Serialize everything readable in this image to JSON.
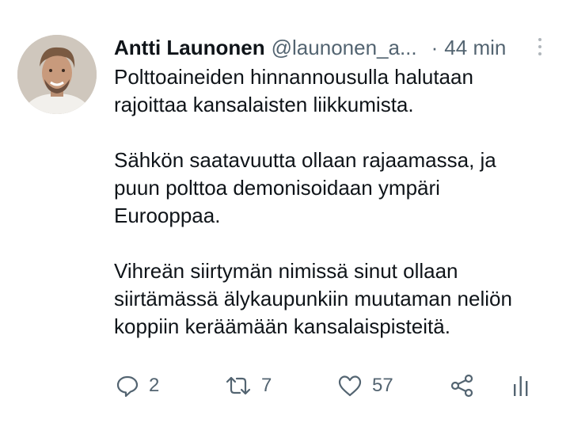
{
  "author": {
    "display_name": "Antti Launonen",
    "handle": "@launonen_a...",
    "separator": "·",
    "time": "44 min"
  },
  "tweet": {
    "lines": [
      "Polttoaineiden hinnannousulla halutaan",
      "rajoittaa kansalaisten liikkumista.",
      "Sähkön saatavuutta ollaan rajaamassa, ja",
      "puun polttoa demonisoidaan ympäri",
      "Eurooppaa.",
      "Vihreän siirtymän nimissä sinut ollaan",
      "siirtämässä älykaupunkiin muutaman neliön",
      "koppiin keräämään kansalaispisteitä."
    ]
  },
  "actions": {
    "reply": {
      "icon": "reply-icon",
      "count": "2"
    },
    "retweet": {
      "icon": "retweet-icon",
      "count": "7"
    },
    "like": {
      "icon": "heart-icon",
      "count": "57"
    },
    "share": {
      "icon": "share-icon"
    },
    "analytics": {
      "icon": "analytics-icon"
    }
  },
  "colors": {
    "text": "#0f1419",
    "secondary": "#536471",
    "background": "#ffffff"
  }
}
